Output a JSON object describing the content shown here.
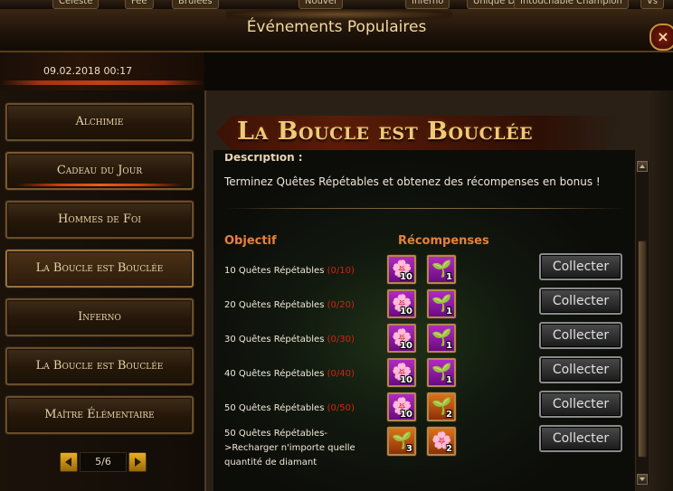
{
  "top_tabs": [
    "Céleste",
    "Fée",
    "Brûlées",
    "Nouvel",
    "Inferno",
    "Unique Divine",
    "Intouchable Champion",
    "Vs"
  ],
  "window": {
    "title": "Événements Populaires",
    "close_icon": "close-icon"
  },
  "date": "09.02.2018 00:17",
  "sidebar": {
    "items": [
      {
        "label": "Alchimie"
      },
      {
        "label": "Cadeau du Jour"
      },
      {
        "label": "Hommes de Foi"
      },
      {
        "label": "La Boucle est Bouclée"
      },
      {
        "label": "Inferno"
      },
      {
        "label": "La Boucle est Bouclée"
      },
      {
        "label": "Maître Élémentaire"
      }
    ],
    "selected_index": 3
  },
  "pager": {
    "label": "5/6"
  },
  "event": {
    "title": "La Boucle est Bouclée",
    "description_label": "Description :",
    "description": "Terminez Quêtes Répétables et obtenez des récompenses en bonus !",
    "headers": {
      "objective": "Objectif",
      "rewards": "Récompenses"
    },
    "collect_label": "Collecter",
    "rows": [
      {
        "objective": "10 Quêtes Répétables",
        "progress": "(0/10)",
        "rewards": [
          {
            "icon": "flower-icon",
            "qty": "10",
            "color": "purple"
          },
          {
            "icon": "sprout-icon",
            "qty": "1",
            "color": "purple"
          }
        ]
      },
      {
        "objective": "20 Quêtes Répétables",
        "progress": "(0/20)",
        "rewards": [
          {
            "icon": "flower-icon",
            "qty": "10",
            "color": "purple"
          },
          {
            "icon": "sprout-icon",
            "qty": "1",
            "color": "purple"
          }
        ]
      },
      {
        "objective": "30 Quêtes Répétables",
        "progress": "(0/30)",
        "rewards": [
          {
            "icon": "flower-icon",
            "qty": "10",
            "color": "purple"
          },
          {
            "icon": "sprout-icon",
            "qty": "1",
            "color": "purple"
          }
        ]
      },
      {
        "objective": "40 Quêtes Répétables",
        "progress": "(0/40)",
        "rewards": [
          {
            "icon": "flower-icon",
            "qty": "10",
            "color": "purple"
          },
          {
            "icon": "sprout-icon",
            "qty": "1",
            "color": "purple"
          }
        ]
      },
      {
        "objective": "50 Quêtes Répétables",
        "progress": "(0/50)",
        "rewards": [
          {
            "icon": "flower-icon",
            "qty": "10",
            "color": "purple"
          },
          {
            "icon": "sprout-icon",
            "qty": "2",
            "color": "orange"
          }
        ]
      },
      {
        "objective": "50 Quêtes Répétables->Recharger n'importe quelle quantité de diamant",
        "progress": "",
        "rewards": [
          {
            "icon": "sprout-icon",
            "qty": "3",
            "color": "orange"
          },
          {
            "icon": "flower-icon",
            "qty": "2",
            "color": "orange"
          }
        ]
      }
    ]
  }
}
